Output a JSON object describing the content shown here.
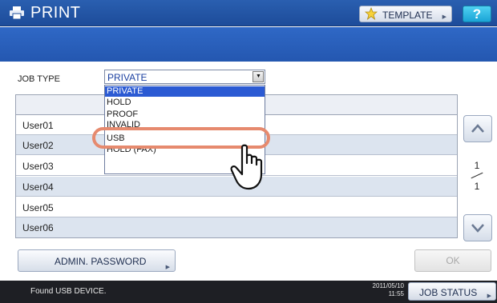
{
  "header": {
    "title": "PRINT",
    "template_label": "TEMPLATE",
    "help_label": "?"
  },
  "job_type": {
    "label": "JOB TYPE",
    "selected": "PRIVATE",
    "options": [
      "PRIVATE",
      "HOLD",
      "PROOF",
      "INVALID",
      "USB",
      "HOLD (FAX)"
    ]
  },
  "table": {
    "rows": [
      "User01",
      "User02",
      "User03",
      "User04",
      "User05",
      "User06"
    ]
  },
  "pagination": {
    "current": "1",
    "total": "1"
  },
  "buttons": {
    "admin_password": "ADMIN. PASSWORD",
    "ok": "OK",
    "job_status": "JOB STATUS"
  },
  "status_bar": {
    "message": "Found USB DEVICE.",
    "date": "2011/05/10",
    "time": "11:55"
  },
  "colors": {
    "header": "#1d4c9a",
    "band": "#2457b0",
    "selected_option": "#2b5ad3",
    "highlight": "#e68a6e",
    "help_button": "#1aa4d6",
    "status_bar": "#1e1f24"
  },
  "icons": [
    "printer-icon",
    "star-icon",
    "chevron-up-icon",
    "chevron-down-icon",
    "pointing-hand-icon"
  ]
}
